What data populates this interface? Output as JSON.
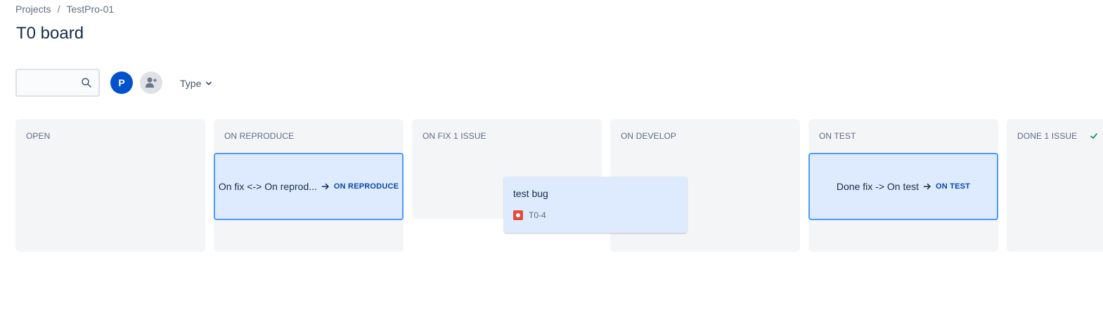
{
  "breadcrumb": {
    "items": [
      "Projects",
      "TestPro-01"
    ],
    "separator": "/"
  },
  "page_title": "T0 board",
  "toolbar": {
    "search": {
      "value": "",
      "placeholder": ""
    },
    "avatar_initial": "P",
    "type_filter_label": "Type"
  },
  "columns": [
    {
      "title": "OPEN"
    },
    {
      "title": "ON REPRODUCE",
      "transition": {
        "label": "On fix <-> On reprod...",
        "target": "ON REPRODUCE"
      }
    },
    {
      "title": "ON FIX 1 ISSUE"
    },
    {
      "title": "ON DEVELOP"
    },
    {
      "title": "ON TEST",
      "transition": {
        "label": "Done fix -> On test",
        "target": "ON TEST"
      }
    },
    {
      "title": "DONE 1 ISSUE"
    }
  ],
  "dragged_card": {
    "summary": "test bug",
    "key": "T0-4",
    "issue_type_icon": "bug-icon"
  },
  "colors": {
    "primary": "#0052cc",
    "drop_zone_bg": "#deebff",
    "drop_zone_border": "#4c9aff",
    "column_bg": "#f4f5f7",
    "bug": "#e5493a",
    "done_check": "#00875a"
  }
}
